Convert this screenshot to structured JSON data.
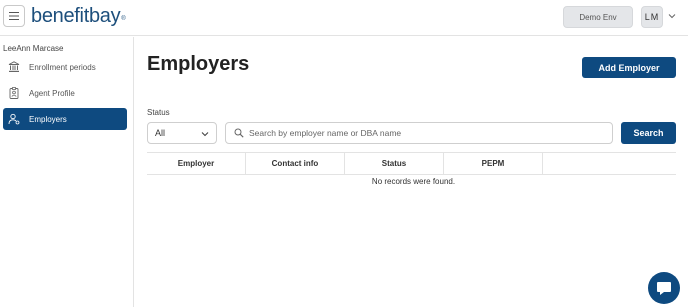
{
  "header": {
    "menu_icon": "hamburger-icon",
    "logo_text": "benefitbay",
    "logo_tm": "®",
    "env_label": "Demo Env",
    "avatar_initials": "LM",
    "avatar_menu_icon": "chevron-down-icon"
  },
  "sidebar": {
    "user_name": "LeeAnn Marcase",
    "items": [
      {
        "label": "Enrollment periods",
        "icon": "bank-icon",
        "active": false
      },
      {
        "label": "Agent Profile",
        "icon": "id-badge-icon",
        "active": false
      },
      {
        "label": "Employers",
        "icon": "users-icon",
        "active": true
      }
    ]
  },
  "main": {
    "title": "Employers",
    "add_button": "Add Employer",
    "status_label": "Status",
    "status_value": "All",
    "search_placeholder": "Search by employer name or DBA name",
    "search_button": "Search",
    "table": {
      "columns": [
        "Employer",
        "Contact info",
        "Status",
        "PEPM",
        ""
      ],
      "empty_message": "No records were found."
    }
  },
  "colors": {
    "accent": "#0e4a80",
    "logo": "#1d4f7c"
  },
  "chat_icon": "chat-bubble-icon"
}
